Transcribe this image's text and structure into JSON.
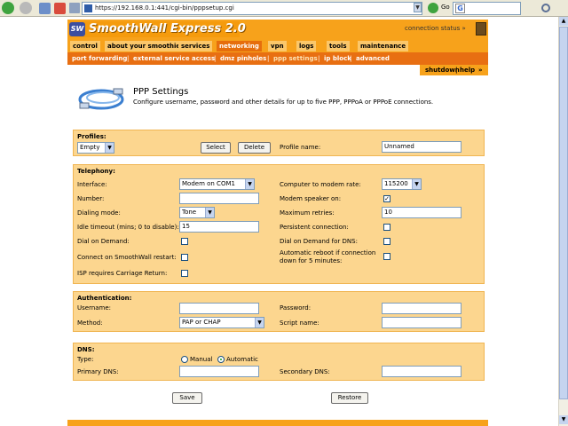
{
  "browser": {
    "url": "https://192.168.0.1:441/cgi-bin/pppsetup.cgi",
    "go_label": "Go",
    "search_value": ""
  },
  "header": {
    "logo_text": "SmoothWall Express 2.0",
    "logo_mark": "SW",
    "connection_status": "connection status »"
  },
  "nav": {
    "main": [
      "control",
      "about your smoothie",
      "services",
      "networking",
      "vpn",
      "logs",
      "tools",
      "maintenance"
    ],
    "active_main": "networking",
    "sub": [
      "port forwarding",
      "external service access",
      "dmz pinholes",
      "ppp settings",
      "ip block",
      "advanced"
    ],
    "active_sub": "ppp settings",
    "shutdown": "shutdown",
    "help": "help"
  },
  "page": {
    "title": "PPP Settings",
    "description": "Configure username, password and other details for up to five PPP, PPPoA or PPPoE connections."
  },
  "profiles": {
    "title": "Profiles:",
    "selected": "Empty",
    "select_btn": "Select",
    "delete_btn": "Delete",
    "name_label": "Profile name:",
    "name_value": "Unnamed"
  },
  "telephony": {
    "title": "Telephony:",
    "interface_label": "Interface:",
    "interface_value": "Modem on COM1",
    "rate_label": "Computer to modem rate:",
    "rate_value": "115200",
    "number_label": "Number:",
    "number_value": "",
    "speaker_label": "Modem speaker on:",
    "speaker_checked": true,
    "dialing_label": "Dialing mode:",
    "dialing_value": "Tone",
    "retries_label": "Maximum retries:",
    "retries_value": "10",
    "idle_label": "Idle timeout (mins; 0 to disable):",
    "idle_value": "15",
    "persistent_label": "Persistent connection:",
    "persistent_checked": false,
    "dod_label": "Dial on Demand:",
    "dod_checked": false,
    "dod_dns_label": "Dial on Demand for DNS:",
    "dod_dns_checked": false,
    "connect_restart_label": "Connect on SmoothWall restart:",
    "connect_restart_checked": false,
    "auto_reboot_label_1": "Automatic reboot if connection",
    "auto_reboot_label_2": "down for 5 minutes:",
    "auto_reboot_checked": false,
    "carriage_label": "ISP requires Carriage Return:",
    "carriage_checked": false
  },
  "authentication": {
    "title": "Authentication:",
    "username_label": "Username:",
    "username_value": "",
    "password_label": "Password:",
    "password_value": "",
    "method_label": "Method:",
    "method_value": "PAP or CHAP",
    "script_label": "Script name:",
    "script_value": ""
  },
  "dns": {
    "title": "DNS:",
    "type_label": "Type:",
    "manual_label": "Manual",
    "automatic_label": "Automatic",
    "selected": "Automatic",
    "primary_label": "Primary DNS:",
    "primary_value": "",
    "secondary_label": "Secondary DNS:",
    "secondary_value": ""
  },
  "actions": {
    "save": "Save",
    "restore": "Restore"
  },
  "colors": {
    "brand_orange": "#f7a21b",
    "sub_nav": "#e86f12",
    "panel": "#fcd68f"
  }
}
